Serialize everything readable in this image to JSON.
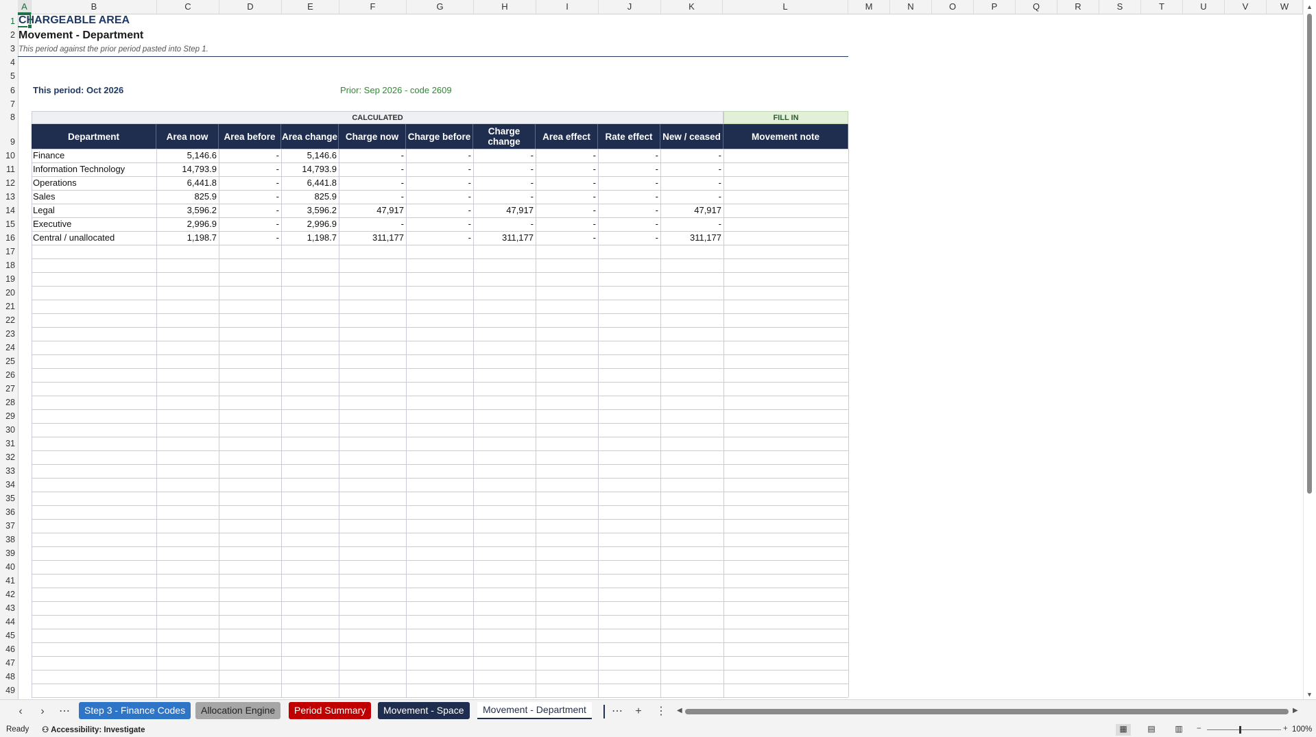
{
  "columns": [
    "A",
    "B",
    "C",
    "D",
    "E",
    "F",
    "G",
    "H",
    "I",
    "J",
    "K",
    "L",
    "M",
    "N",
    "O",
    "P",
    "Q",
    "R",
    "S",
    "T",
    "U",
    "V",
    "W"
  ],
  "rows_start": 1,
  "rows_end": 49,
  "active_cell": "A1",
  "sheet": {
    "title": "CHARGEABLE AREA",
    "subtitle": "Movement - Department",
    "note": "This period against the prior period pasted into Step 1.",
    "this_period": "This period: Oct 2026",
    "prior": "Prior: Sep 2026 - code 2609",
    "group_calculated": "CALCULATED",
    "group_fill_in": "FILL IN",
    "headers": [
      "Department",
      "Area now",
      "Area before",
      "Area change",
      "Charge now",
      "Charge before",
      "Charge change",
      "Area effect",
      "Rate effect",
      "New / ceased",
      "Movement note"
    ],
    "rows": [
      [
        "Finance",
        "5,146.6",
        "-",
        "5,146.6",
        "-",
        "-",
        "-",
        "-",
        "-",
        "-",
        ""
      ],
      [
        "Information Technology",
        "14,793.9",
        "-",
        "14,793.9",
        "-",
        "-",
        "-",
        "-",
        "-",
        "-",
        ""
      ],
      [
        "Operations",
        "6,441.8",
        "-",
        "6,441.8",
        "-",
        "-",
        "-",
        "-",
        "-",
        "-",
        ""
      ],
      [
        "Sales",
        "825.9",
        "-",
        "825.9",
        "-",
        "-",
        "-",
        "-",
        "-",
        "-",
        ""
      ],
      [
        "Legal",
        "3,596.2",
        "-",
        "3,596.2",
        "47,917",
        "-",
        "47,917",
        "-",
        "-",
        "47,917",
        ""
      ],
      [
        "Executive",
        "2,996.9",
        "-",
        "2,996.9",
        "-",
        "-",
        "-",
        "-",
        "-",
        "-",
        ""
      ],
      [
        "Central / unallocated",
        "1,198.7",
        "-",
        "1,198.7",
        "311,177",
        "-",
        "311,177",
        "-",
        "-",
        "311,177",
        ""
      ]
    ]
  },
  "tabs": [
    {
      "label": "Step 3 - Finance Codes",
      "style": "blue"
    },
    {
      "label": "Allocation Engine",
      "style": "grey"
    },
    {
      "label": "Period Summary",
      "style": "red"
    },
    {
      "label": "Movement - Space",
      "style": "navy"
    },
    {
      "label": "Movement - Department",
      "style": "active"
    }
  ],
  "tab_controls": {
    "prev": "‹",
    "next": "›",
    "more": "⋯",
    "add": "+",
    "menu": "⋮"
  },
  "status": {
    "ready": "Ready",
    "accessibility": "Accessibility: Investigate",
    "zoom": "100%"
  },
  "colors": {
    "header_bg": "#1f2d4e",
    "title": "#1f3864",
    "prior_green": "#2e8b2e",
    "fill_in_bg": "#e2efd9",
    "tab_blue": "#2e75c8",
    "tab_red": "#c00000",
    "tab_grey": "#a6a6a6"
  }
}
